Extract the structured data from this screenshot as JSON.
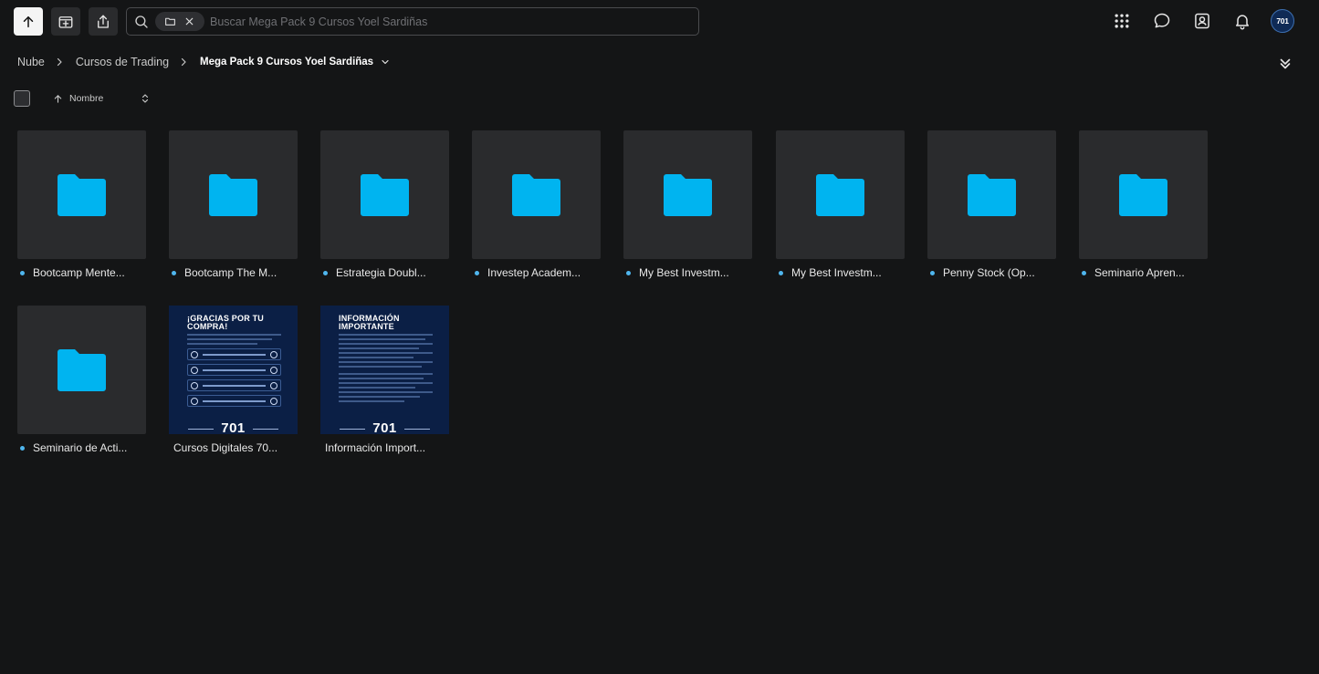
{
  "toolbar": {
    "up_icon": "arrow-up-icon",
    "new_folder_icon": "folder-plus-icon",
    "share_icon": "share-icon"
  },
  "search": {
    "placeholder": "Buscar Mega Pack 9 Cursos Yoel Sardiñas",
    "value": ""
  },
  "header_icons": [
    "apps-grid-icon",
    "chat-icon",
    "contacts-icon",
    "bell-icon"
  ],
  "user": {
    "avatar_text": "701"
  },
  "breadcrumb": {
    "items": [
      "Nube",
      "Cursos de Trading"
    ],
    "current": "Mega Pack 9 Cursos Yoel Sardiñas"
  },
  "sort": {
    "label": "Nombre",
    "direction": "ascending"
  },
  "colors": {
    "folder": "#00b4f0",
    "accent_dot": "#4fb6ee",
    "background": "#141516",
    "tile": "#2a2b2d",
    "poster_bg": "#0b1f45"
  },
  "items": [
    {
      "type": "folder",
      "name": "Bootcamp Mente..."
    },
    {
      "type": "folder",
      "name": "Bootcamp The M..."
    },
    {
      "type": "folder",
      "name": "Estrategia Doubl..."
    },
    {
      "type": "folder",
      "name": "Investep Academ..."
    },
    {
      "type": "folder",
      "name": "My Best Investm..."
    },
    {
      "type": "folder",
      "name": "My Best Investm..."
    },
    {
      "type": "folder",
      "name": "Penny Stock (Op..."
    },
    {
      "type": "folder",
      "name": "Seminario Apren..."
    },
    {
      "type": "folder",
      "name": "Seminario de Acti..."
    },
    {
      "type": "image",
      "name": "Cursos Digitales 70...",
      "poster_title": "¡GRACIAS POR TU COMPRA!",
      "poster_brand": "701"
    },
    {
      "type": "image",
      "name": "Información Import...",
      "poster_title": "INFORMACIÓN IMPORTANTE",
      "poster_brand": "701"
    }
  ]
}
